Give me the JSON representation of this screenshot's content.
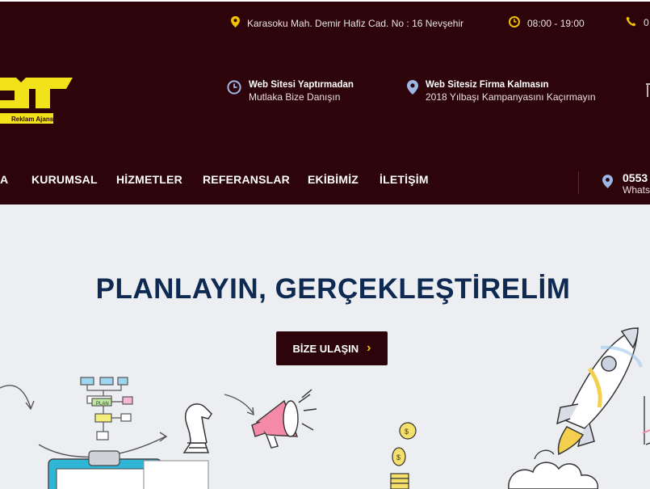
{
  "topbar": {
    "address": "Karasoku Mah. Demir Hafiz Cad. No : 16 Nevşehir",
    "hours": "08:00 - 19:00",
    "phone_partial": "0",
    "colors": {
      "background": "#2c0409",
      "accent": "#f2c200"
    }
  },
  "logo": {
    "tagline": "Reklam Ajansı"
  },
  "info": [
    {
      "title": "Web Sitesi Yaptırmadan",
      "subtitle": "Mutlaka Bize Danışın",
      "icon": "clock-icon"
    },
    {
      "title": "Web Sitesiz Firma Kalmasın",
      "subtitle": "2018 Yılbaşı Kampanyasını Kaçırmayın",
      "icon": "map-pin-icon"
    }
  ],
  "nav": {
    "items": [
      "A",
      "KURUMSAL",
      "HİZMETLER",
      "REFERANSLAR",
      "EKİBİMİZ",
      "İLETİŞİM"
    ]
  },
  "contact": {
    "phone": "0553",
    "whatsapp": "Whats"
  },
  "hero": {
    "title": "PLANLAYIN, GERÇEKLEŞTİRELİM",
    "cta_label": "BİZE ULAŞIN",
    "sketch_plan_label": "PLAN",
    "colors": {
      "title": "#0f2a52",
      "button": "#2c0409"
    }
  }
}
